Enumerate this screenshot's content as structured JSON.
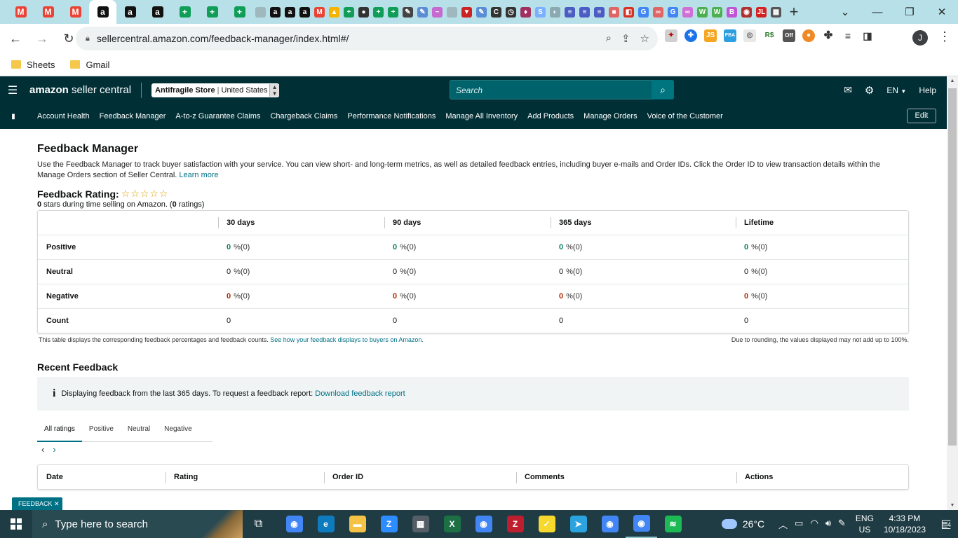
{
  "browser": {
    "url": "sellercentral.amazon.com/feedback-manager/index.html#/",
    "bookmarks": [
      {
        "label": "Sheets"
      },
      {
        "label": "Gmail"
      }
    ],
    "profile_initial": "J",
    "ext_badge": "Off",
    "tab_icons": [
      {
        "icon": "gmail-icon",
        "color": "#ea4335",
        "glyph": "M"
      },
      {
        "icon": "gmail-icon",
        "color": "#ea4335",
        "glyph": "M"
      },
      {
        "icon": "gmail-icon",
        "color": "#ea4335",
        "glyph": "M"
      },
      {
        "icon": "amazon-icon",
        "color": "#111111",
        "glyph": "a",
        "active": true
      },
      {
        "icon": "amazon-icon",
        "color": "#111111",
        "glyph": "a"
      },
      {
        "icon": "amazon-icon",
        "color": "#111111",
        "glyph": "a"
      },
      {
        "icon": "sheets-icon",
        "color": "#0f9d58",
        "glyph": "+"
      },
      {
        "icon": "sheets-icon",
        "color": "#0f9d58",
        "glyph": "+"
      },
      {
        "icon": "sheets-icon",
        "color": "#0f9d58",
        "glyph": "+"
      }
    ],
    "small_tab_icons": [
      {
        "icon": "loading-icon",
        "color": "#9fb8bd",
        "glyph": ""
      },
      {
        "icon": "amazon-icon",
        "color": "#111111",
        "glyph": "a"
      },
      {
        "icon": "amazon-icon",
        "color": "#111111",
        "glyph": "a"
      },
      {
        "icon": "amazon-icon",
        "color": "#111111",
        "glyph": "a"
      },
      {
        "icon": "gmail-icon",
        "color": "#ea4335",
        "glyph": "M"
      },
      {
        "icon": "drive-icon",
        "color": "#f4b400",
        "glyph": "▲"
      },
      {
        "icon": "sheets-icon",
        "color": "#0f9d58",
        "glyph": "+"
      },
      {
        "icon": "user-icon",
        "color": "#333333",
        "glyph": "●"
      },
      {
        "icon": "sheets-icon",
        "color": "#0f9d58",
        "glyph": "+"
      },
      {
        "icon": "sheets-icon",
        "color": "#0f9d58",
        "glyph": "+"
      },
      {
        "icon": "pen-icon",
        "color": "#444444",
        "glyph": "✎"
      },
      {
        "icon": "pen-icon",
        "color": "#5b8dd6",
        "glyph": "✎"
      },
      {
        "icon": "ext-icon",
        "color": "#c66ad1",
        "glyph": "~"
      },
      {
        "icon": "loading-icon",
        "color": "#9fb8bd",
        "glyph": ""
      },
      {
        "icon": "vpn-icon",
        "color": "#cc2222",
        "glyph": "▼"
      },
      {
        "icon": "pen-icon",
        "color": "#5b8dd6",
        "glyph": "✎"
      },
      {
        "icon": "clock-icon",
        "color": "#333333",
        "glyph": "C"
      },
      {
        "icon": "history-icon",
        "color": "#333333",
        "glyph": "◷"
      },
      {
        "icon": "image-icon",
        "color": "#a03060",
        "glyph": "♦"
      },
      {
        "icon": "s-icon",
        "color": "#7ab0ff",
        "glyph": "S"
      },
      {
        "icon": "telegram-icon",
        "color": "#8aa9b0",
        "glyph": "◐"
      },
      {
        "icon": "list-icon",
        "color": "#4b5cc4",
        "glyph": "≡"
      },
      {
        "icon": "list-icon",
        "color": "#4b5cc4",
        "glyph": "≡"
      },
      {
        "icon": "list-icon",
        "color": "#4b5cc4",
        "glyph": "≡"
      },
      {
        "icon": "slides-icon",
        "color": "#e06666",
        "glyph": "■"
      },
      {
        "icon": "pdf-icon",
        "color": "#d93025",
        "glyph": "◧"
      },
      {
        "icon": "google-icon",
        "color": "#4285f4",
        "glyph": "G"
      },
      {
        "icon": "ext-icon",
        "color": "#e06666",
        "glyph": "∞"
      },
      {
        "icon": "google-icon",
        "color": "#4285f4",
        "glyph": "G"
      },
      {
        "icon": "ext-icon",
        "color": "#d06fd6",
        "glyph": "∞"
      },
      {
        "icon": "w-icon",
        "color": "#4caf50",
        "glyph": "W"
      },
      {
        "icon": "w-icon",
        "color": "#4caf50",
        "glyph": "W"
      },
      {
        "icon": "b-icon",
        "color": "#c056d6",
        "glyph": "B"
      },
      {
        "icon": "ext-icon",
        "color": "#b03030",
        "glyph": "◉"
      },
      {
        "icon": "ext-icon",
        "color": "#d42020",
        "glyph": "JL"
      },
      {
        "icon": "clapper-icon",
        "color": "#555555",
        "glyph": "▦"
      }
    ]
  },
  "header": {
    "logo_bold": "amazon",
    "logo_rest": " seller central",
    "store_name": "Antifragile Store",
    "store_region": "United States",
    "search_placeholder": "Search",
    "language": "EN",
    "help": "Help"
  },
  "nav": {
    "items": [
      "Account Health",
      "Feedback Manager",
      "A-to-z Guarantee Claims",
      "Chargeback Claims",
      "Performance Notifications",
      "Manage All Inventory",
      "Add Products",
      "Manage Orders",
      "Voice of the Customer"
    ],
    "edit": "Edit"
  },
  "page": {
    "title": "Feedback Manager",
    "intro": "Use the Feedback Manager to track buyer satisfaction with your service. You can view short- and long-term metrics, as well as detailed feedback entries, including buyer e-mails and Order IDs. Click the Order ID to view transaction details within the Manage Orders section of Seller Central.",
    "learn_more": "Learn more",
    "rating_label": "Feedback Rating:",
    "stars_glyphs": "☆☆☆☆☆",
    "rating_count_stars": "0",
    "rating_sub_mid": " stars during time selling on Amazon. (",
    "rating_count_ratings": "0",
    "rating_sub_end": " ratings)",
    "rating_stars_value": 0,
    "metrics": {
      "columns": [
        "30 days",
        "90 days",
        "365 days",
        "Lifetime"
      ],
      "rows": [
        {
          "label": "Positive",
          "kind": "positive",
          "cells": [
            {
              "value": "0",
              "pct": "%(0)"
            },
            {
              "value": "0",
              "pct": "%(0)"
            },
            {
              "value": "0",
              "pct": "%(0)"
            },
            {
              "value": "0",
              "pct": "%(0)"
            }
          ]
        },
        {
          "label": "Neutral",
          "kind": "neutral",
          "cells": [
            {
              "value": "0",
              "pct": "%(0)"
            },
            {
              "value": "0",
              "pct": "%(0)"
            },
            {
              "value": "0",
              "pct": "%(0)"
            },
            {
              "value": "0",
              "pct": "%(0)"
            }
          ]
        },
        {
          "label": "Negative",
          "kind": "negative",
          "cells": [
            {
              "value": "0",
              "pct": "%(0)"
            },
            {
              "value": "0",
              "pct": "%(0)"
            },
            {
              "value": "0",
              "pct": "%(0)"
            },
            {
              "value": "0",
              "pct": "%(0)"
            }
          ]
        },
        {
          "label": "Count",
          "kind": "count",
          "cells": [
            {
              "value": "0",
              "pct": ""
            },
            {
              "value": "0",
              "pct": ""
            },
            {
              "value": "0",
              "pct": ""
            },
            {
              "value": "0",
              "pct": ""
            }
          ]
        }
      ]
    },
    "table_note": "This table displays the corresponding feedback percentages and feedback counts.",
    "table_note_link": "See how your feedback displays to buyers on Amazon.",
    "rounding_note": "Due to rounding, the values displayed may not add up to 100%.",
    "recent_title": "Recent Feedback",
    "info_text": "Displaying feedback from the last 365 days. To request a feedback report:",
    "info_link": "Download feedback report",
    "tabs": [
      "All ratings",
      "Positive",
      "Neutral",
      "Negative"
    ],
    "feedback_columns": [
      "Date",
      "Rating",
      "Order ID",
      "Comments",
      "Actions"
    ],
    "feedback_tag": "FEEDBACK ✕"
  },
  "taskbar": {
    "search_placeholder": "Type here to search",
    "apps": [
      {
        "icon": "chrome-icon",
        "color": "#4285f4",
        "glyph": "◉"
      },
      {
        "icon": "edge-icon",
        "color": "#0f7bbf",
        "glyph": "e"
      },
      {
        "icon": "file-explorer-icon",
        "color": "#f4c244",
        "glyph": "▬"
      },
      {
        "icon": "zoom-icon",
        "color": "#2d8cff",
        "glyph": "Z"
      },
      {
        "icon": "calculator-icon",
        "color": "#555e66",
        "glyph": "▦"
      },
      {
        "icon": "excel-icon",
        "color": "#1d7044",
        "glyph": "X"
      },
      {
        "icon": "chrome-icon",
        "color": "#4285f4",
        "glyph": "◉"
      },
      {
        "icon": "filezilla-icon",
        "color": "#bf1e2e",
        "glyph": "Z"
      },
      {
        "icon": "sticky-notes-icon",
        "color": "#f7d82e",
        "glyph": "✓"
      },
      {
        "icon": "telegram-icon",
        "color": "#2aa3df",
        "glyph": "➤"
      },
      {
        "icon": "chrome-icon",
        "color": "#4285f4",
        "glyph": "◉"
      },
      {
        "icon": "chrome-icon",
        "color": "#4285f4",
        "glyph": "◉",
        "open": true
      },
      {
        "icon": "spotify-icon",
        "color": "#1db954",
        "glyph": "≋"
      }
    ],
    "temperature": "26°C",
    "lang_top": "ENG",
    "lang_bottom": "US",
    "time": "4:33 PM",
    "date": "10/18/2023",
    "notifications": "4"
  }
}
